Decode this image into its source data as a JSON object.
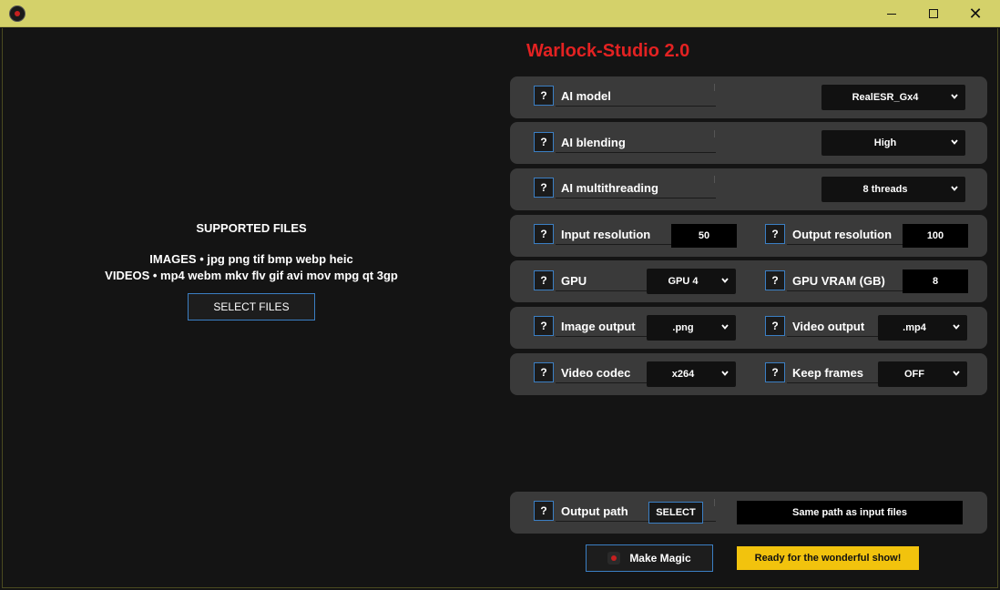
{
  "window": {
    "minimize_glyph": "",
    "close_glyph": "✕"
  },
  "title": "Warlock-Studio 2.0",
  "left": {
    "supported_title": "SUPPORTED FILES",
    "images_line": "IMAGES • jpg png tif bmp webp heic",
    "videos_line": "VIDEOS • mp4 webm mkv flv gif avi mov mpg qt 3gp",
    "select_files": "SELECT FILES"
  },
  "help_glyph": "?",
  "settings": {
    "ai_model": {
      "label": "AI model",
      "value": "RealESR_Gx4"
    },
    "ai_blending": {
      "label": "AI blending",
      "value": "High"
    },
    "ai_multithreading": {
      "label": "AI multithreading",
      "value": "8 threads"
    },
    "input_resolution": {
      "label": "Input resolution",
      "value": "50"
    },
    "output_resolution": {
      "label": "Output resolution",
      "value": "100"
    },
    "gpu": {
      "label": "GPU",
      "value": "GPU 4"
    },
    "gpu_vram": {
      "label": "GPU VRAM (GB)",
      "value": "8"
    },
    "image_output": {
      "label": "Image output",
      "value": ".png"
    },
    "video_output": {
      "label": "Video output",
      "value": ".mp4"
    },
    "video_codec": {
      "label": "Video codec",
      "value": "x264"
    },
    "keep_frames": {
      "label": "Keep frames",
      "value": "OFF"
    },
    "output_path": {
      "label": "Output path",
      "button": "SELECT",
      "value": "Same path as input files"
    }
  },
  "actions": {
    "make_magic": "Make Magic",
    "status": "Ready for the wonderful show!"
  },
  "colors": {
    "titlebar": "#d4d16a",
    "accent_blue": "#3b7fc4",
    "title_red": "#e32222",
    "status_yellow": "#f2c30d",
    "panel_bg": "#3a3a3a"
  }
}
